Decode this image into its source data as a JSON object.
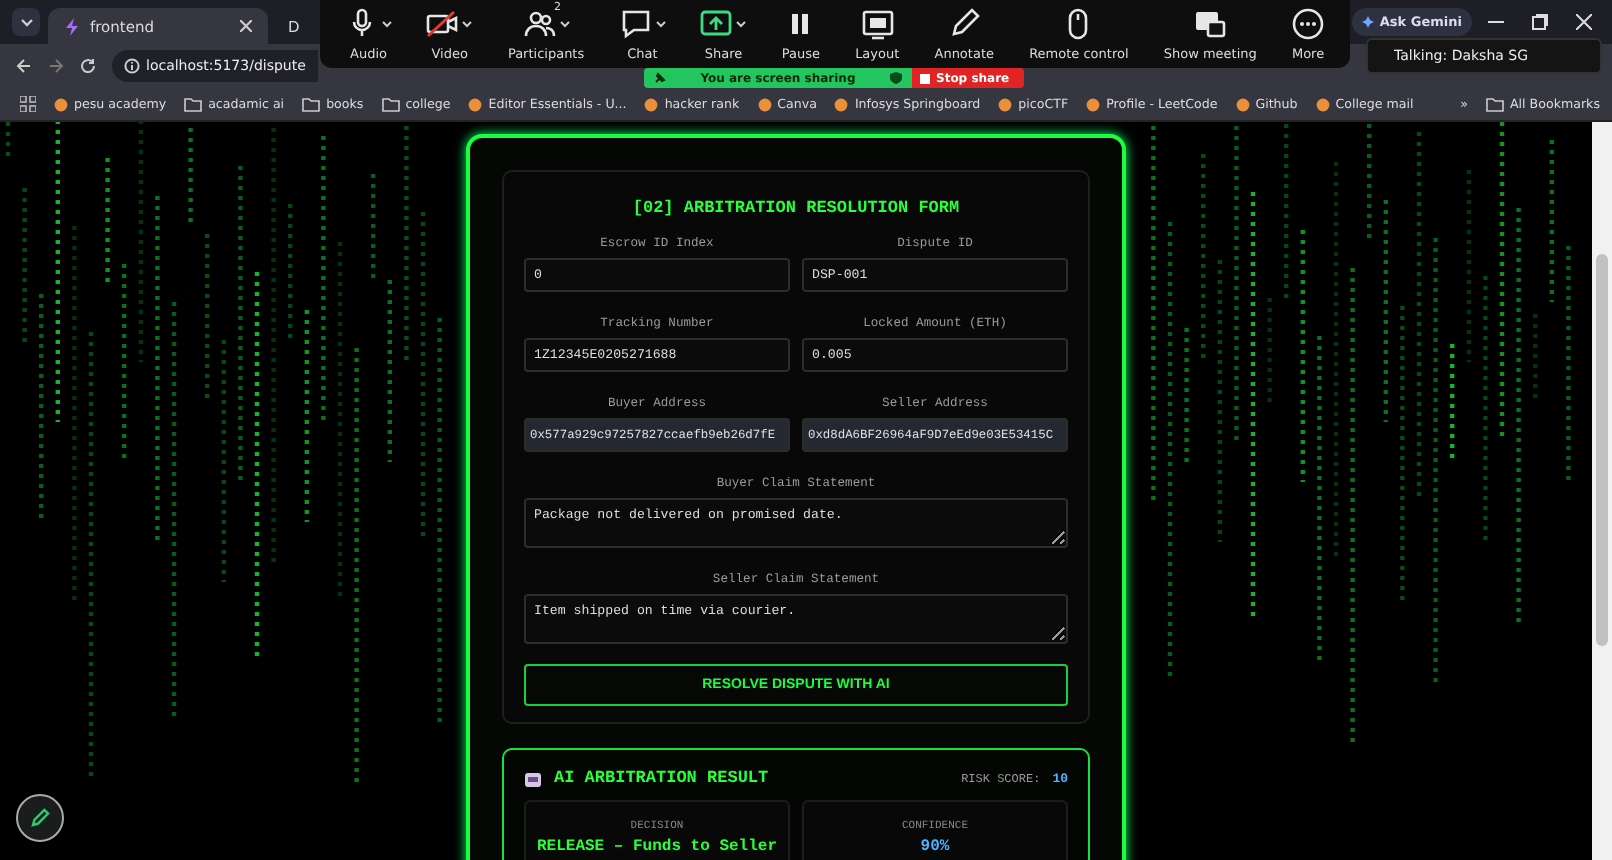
{
  "browser": {
    "tabs": [
      {
        "title": "frontend",
        "selected": true
      },
      {
        "title": "D",
        "selected": false
      }
    ],
    "address": "localhost:5173/dispute",
    "ask_gemini": "Ask Gemini",
    "bookmarks": [
      {
        "label": "pesu academy",
        "kind": "site"
      },
      {
        "label": "acadamic ai",
        "kind": "folder"
      },
      {
        "label": "books",
        "kind": "folder"
      },
      {
        "label": "college",
        "kind": "folder"
      },
      {
        "label": "Editor Essentials - U...",
        "kind": "site"
      },
      {
        "label": "hacker rank",
        "kind": "site"
      },
      {
        "label": "Canva",
        "kind": "site"
      },
      {
        "label": "Infosys Springboard",
        "kind": "site"
      },
      {
        "label": "picoCTF",
        "kind": "site"
      },
      {
        "label": "Profile - LeetCode",
        "kind": "site"
      },
      {
        "label": "Github",
        "kind": "site"
      },
      {
        "label": "College mail",
        "kind": "site"
      }
    ],
    "more_bookmarks": "»",
    "all_bookmarks": "All Bookmarks"
  },
  "meeting": {
    "tools": [
      {
        "label": "Audio",
        "kind": "mic",
        "caret": true
      },
      {
        "label": "Video",
        "kind": "video-off",
        "caret": true
      },
      {
        "label": "Participants",
        "kind": "people",
        "caret": true,
        "badge": "2"
      },
      {
        "label": "Chat",
        "kind": "chat",
        "caret": true
      },
      {
        "label": "Share",
        "kind": "share",
        "caret": true
      },
      {
        "label": "Pause",
        "kind": "pause",
        "caret": false
      },
      {
        "label": "Layout",
        "kind": "layout",
        "caret": false
      },
      {
        "label": "Annotate",
        "kind": "pen",
        "caret": false
      },
      {
        "label": "Remote control",
        "kind": "mouse",
        "caret": false
      },
      {
        "label": "Show meeting",
        "kind": "window",
        "caret": false
      },
      {
        "label": "More",
        "kind": "more",
        "caret": false
      }
    ],
    "sharing": "You are screen sharing",
    "stop_share": "Stop share",
    "talking": "Talking: Daksha SG"
  },
  "form": {
    "title": "[02] ARBITRATION RESOLUTION FORM",
    "fields": [
      {
        "label": "Escrow ID Index",
        "value": "0",
        "kind": "input"
      },
      {
        "label": "Dispute ID",
        "value": "DSP-001",
        "kind": "input"
      },
      {
        "label": "Tracking Number",
        "value": "1Z12345E0205271688",
        "kind": "input"
      },
      {
        "label": "Locked Amount (ETH)",
        "value": "0.005",
        "kind": "input"
      },
      {
        "label": "Buyer Address",
        "value": "0x577a929c97257827ccaefb9eb26d7fE",
        "kind": "readonly"
      },
      {
        "label": "Seller Address",
        "value": "0xd8dA6BF26964aF9D7eEd9e03E53415C",
        "kind": "readonly"
      },
      {
        "label": "Buyer Claim Statement",
        "value": "Package not delivered on promised date.",
        "kind": "textarea"
      },
      {
        "label": "Seller Claim Statement",
        "value": "Item shipped on time via courier.",
        "kind": "textarea"
      }
    ],
    "button": "RESOLVE DISPUTE WITH AI"
  },
  "result": {
    "title": "AI ARBITRATION RESULT",
    "risk_label": "RISK SCORE:",
    "risk_value": "10",
    "cards": [
      {
        "label": "DECISION",
        "value": "RELEASE – Funds to Seller",
        "kind": "decision"
      },
      {
        "label": "CONFIDENCE",
        "value": "90%",
        "kind": "confidence"
      }
    ]
  }
}
